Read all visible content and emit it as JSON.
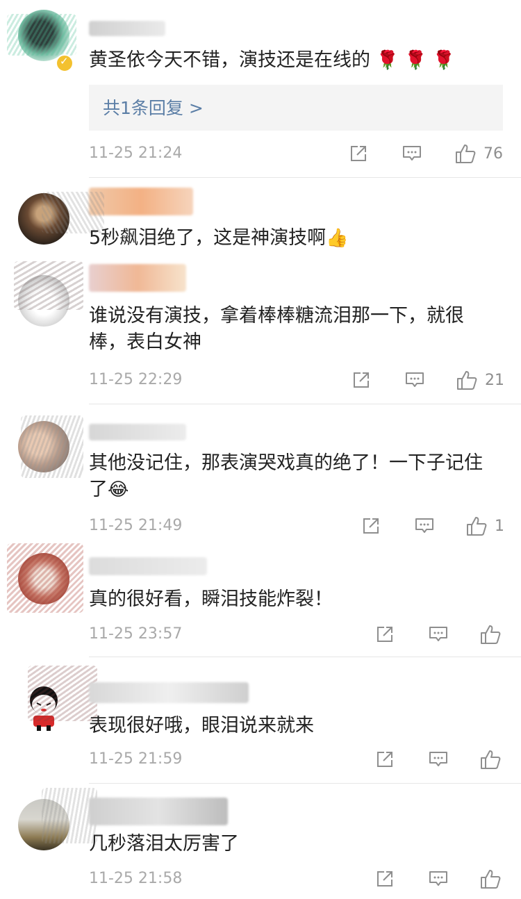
{
  "comments": [
    {
      "text": "黄圣依今天不错，演技还是在线的",
      "emoji": "🌹 🌹 🌹",
      "reply_link": "共1条回复 >",
      "time": "11-25 21:24",
      "likes": "76"
    },
    {
      "text": "5秒飙泪绝了，这是神演技啊",
      "emoji": "👍"
    },
    {
      "text": "谁说没有演技，拿着棒棒糖流泪那一下，就很棒，表白女神",
      "time": "11-25 22:29",
      "likes": "21"
    },
    {
      "text": "其他没记住，那表演哭戏真的绝了！一下子记住了",
      "emoji": "😂",
      "time": "11-25 21:49",
      "likes": "1"
    },
    {
      "text": "真的很好看，瞬泪技能炸裂！",
      "time": "11-25 23:57",
      "likes": ""
    },
    {
      "text": "表现很好哦，眼泪说来就来",
      "time": "11-25 21:59",
      "likes": ""
    },
    {
      "text": "几秒落泪太厉害了",
      "time": "11-25 21:58",
      "likes": ""
    }
  ],
  "icons": {
    "share": "share-icon",
    "comment": "comment-icon",
    "like": "thumbs-up-icon"
  },
  "colors": {
    "link": "#5b7ea6",
    "meta": "#a9a9a9",
    "reply_bg": "#f4f4f4"
  }
}
